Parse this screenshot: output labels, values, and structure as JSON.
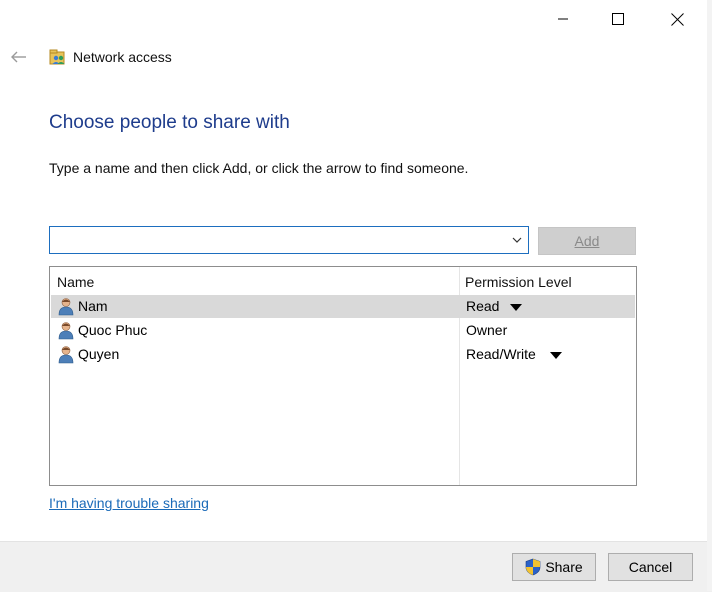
{
  "window": {
    "title": "Network access",
    "controls": {
      "minimize": "minimize-icon",
      "maximize": "maximize-icon",
      "close": "close-icon"
    }
  },
  "heading": "Choose people to share with",
  "instruction": "Type a name and then click Add, or click the arrow to find someone.",
  "name_input": {
    "value": "",
    "placeholder": ""
  },
  "add_button": {
    "label": "Add",
    "enabled": false
  },
  "table": {
    "headers": {
      "name": "Name",
      "permission": "Permission Level"
    },
    "rows": [
      {
        "name": "Nam",
        "permission": "Read",
        "has_dropdown": true,
        "selected": true
      },
      {
        "name": "Quoc Phuc",
        "permission": "Owner",
        "has_dropdown": false,
        "selected": false
      },
      {
        "name": "Quyen",
        "permission": "Read/Write",
        "has_dropdown": true,
        "selected": false
      }
    ]
  },
  "trouble_link": "I'm having trouble sharing",
  "footer": {
    "share_label": "Share",
    "cancel_label": "Cancel"
  },
  "colors": {
    "heading": "#1e3c8c",
    "link": "#1a6ab8",
    "selected_row": "#d9d9d9",
    "input_border": "#1d6ebf"
  }
}
